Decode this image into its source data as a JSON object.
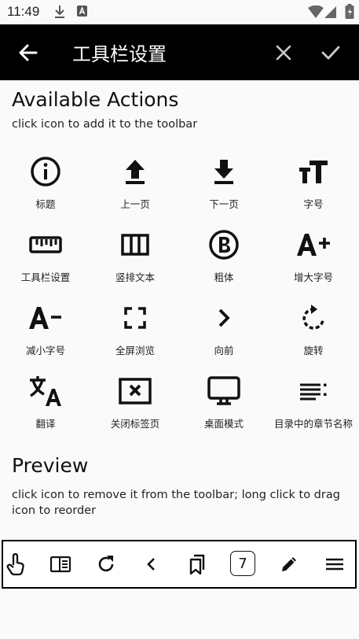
{
  "status_bar": {
    "time": "11:49"
  },
  "app_bar": {
    "title": "工具栏设置"
  },
  "available": {
    "title": "Available Actions",
    "subtitle": "click icon to add it to the toolbar",
    "actions": [
      {
        "label": "标题",
        "icon": "info-icon"
      },
      {
        "label": "上一页",
        "icon": "upload-arrow-icon"
      },
      {
        "label": "下一页",
        "icon": "download-arrow-icon"
      },
      {
        "label": "字号",
        "icon": "font-size-icon"
      },
      {
        "label": "工具栏设置",
        "icon": "ruler-icon"
      },
      {
        "label": "竖排文本",
        "icon": "vertical-columns-icon"
      },
      {
        "label": "粗体",
        "icon": "bold-icon"
      },
      {
        "label": "增大字号",
        "icon": "font-increase-icon"
      },
      {
        "label": "减小字号",
        "icon": "font-decrease-icon"
      },
      {
        "label": "全屏浏览",
        "icon": "fullscreen-icon"
      },
      {
        "label": "向前",
        "icon": "chevron-right-icon"
      },
      {
        "label": "旋转",
        "icon": "rotate-icon"
      },
      {
        "label": "翻译",
        "icon": "translate-icon"
      },
      {
        "label": "关闭标签页",
        "icon": "close-tab-icon"
      },
      {
        "label": "桌面模式",
        "icon": "desktop-icon"
      },
      {
        "label": "目录中的章节名称",
        "icon": "chapter-list-icon"
      }
    ]
  },
  "preview": {
    "title": "Preview",
    "subtitle": "click icon to remove it from the toolbar; long click to drag icon to reorder",
    "items": [
      {
        "icon": "touch-icon"
      },
      {
        "icon": "reader-mode-icon"
      },
      {
        "icon": "refresh-icon"
      },
      {
        "icon": "chevron-left-icon"
      },
      {
        "icon": "bookmarks-icon"
      },
      {
        "icon": "page-number-icon",
        "value": "7"
      },
      {
        "icon": "edit-icon"
      },
      {
        "icon": "menu-icon"
      }
    ]
  }
}
